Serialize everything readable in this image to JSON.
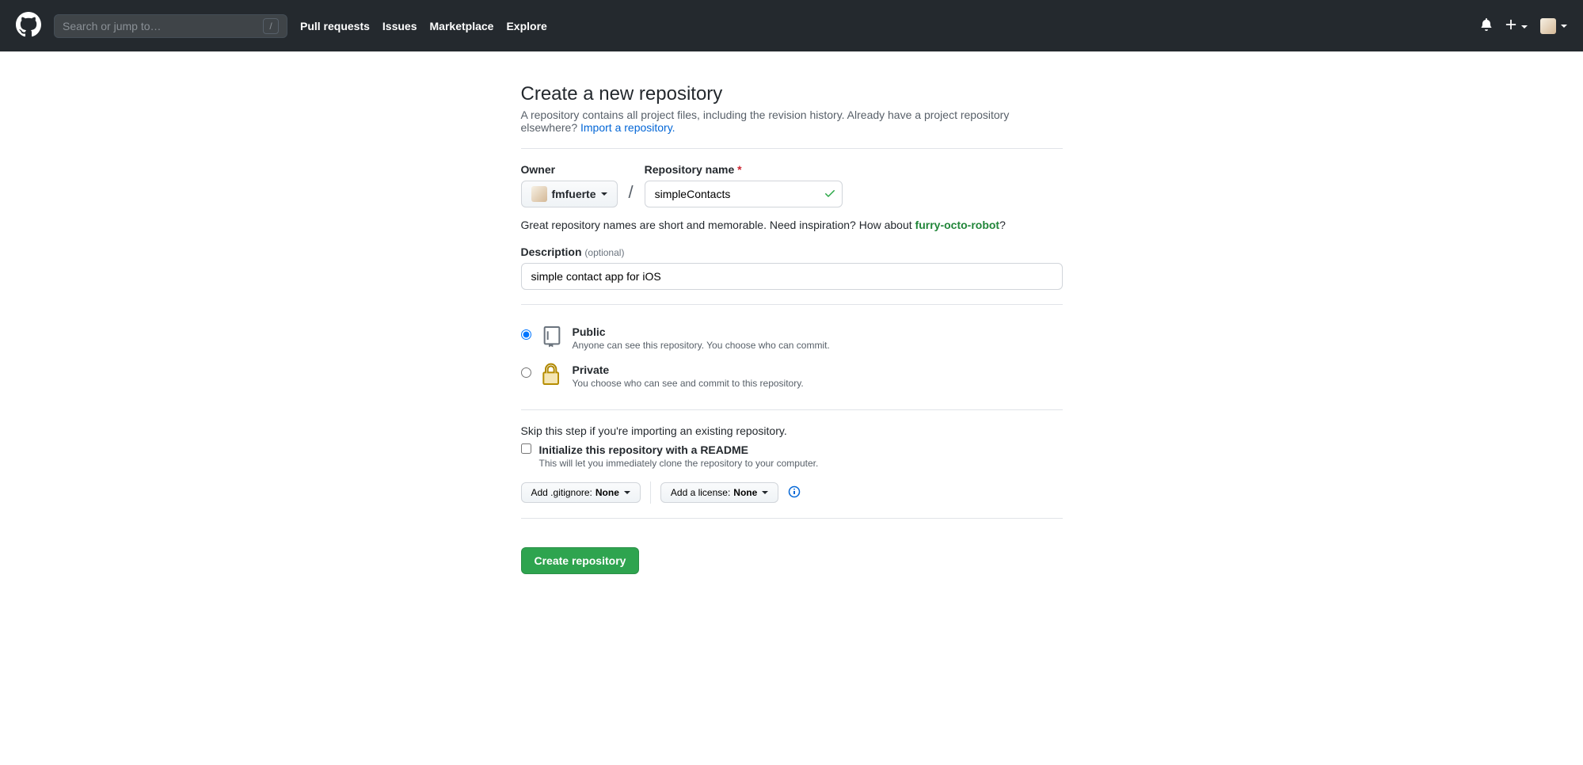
{
  "header": {
    "search_placeholder": "Search or jump to…",
    "slash_key": "/",
    "nav": {
      "pull_requests": "Pull requests",
      "issues": "Issues",
      "marketplace": "Marketplace",
      "explore": "Explore"
    }
  },
  "page": {
    "title": "Create a new repository",
    "subhead_pre": "A repository contains all project files, including the revision history. Already have a project repository elsewhere? ",
    "import_link": "Import a repository."
  },
  "form": {
    "owner_label": "Owner",
    "owner_value": "fmfuerte",
    "repo_label": "Repository name",
    "repo_required": "*",
    "repo_value": "simpleContacts",
    "helper_pre": "Great repository names are short and memorable. Need inspiration? How about ",
    "suggestion": "furry-octo-robot",
    "helper_post": "?",
    "desc_label": "Description",
    "desc_optional": "(optional)",
    "desc_value": "simple contact app for iOS",
    "visibility": {
      "public": {
        "title": "Public",
        "note": "Anyone can see this repository. You choose who can commit."
      },
      "private": {
        "title": "Private",
        "note": "You choose who can see and commit to this repository."
      }
    },
    "skip_text": "Skip this step if you're importing an existing repository.",
    "readme": {
      "title": "Initialize this repository with a README",
      "note": "This will let you immediately clone the repository to your computer."
    },
    "gitignore_label": "Add .gitignore: ",
    "gitignore_value": "None",
    "license_label": "Add a license: ",
    "license_value": "None",
    "submit": "Create repository"
  }
}
